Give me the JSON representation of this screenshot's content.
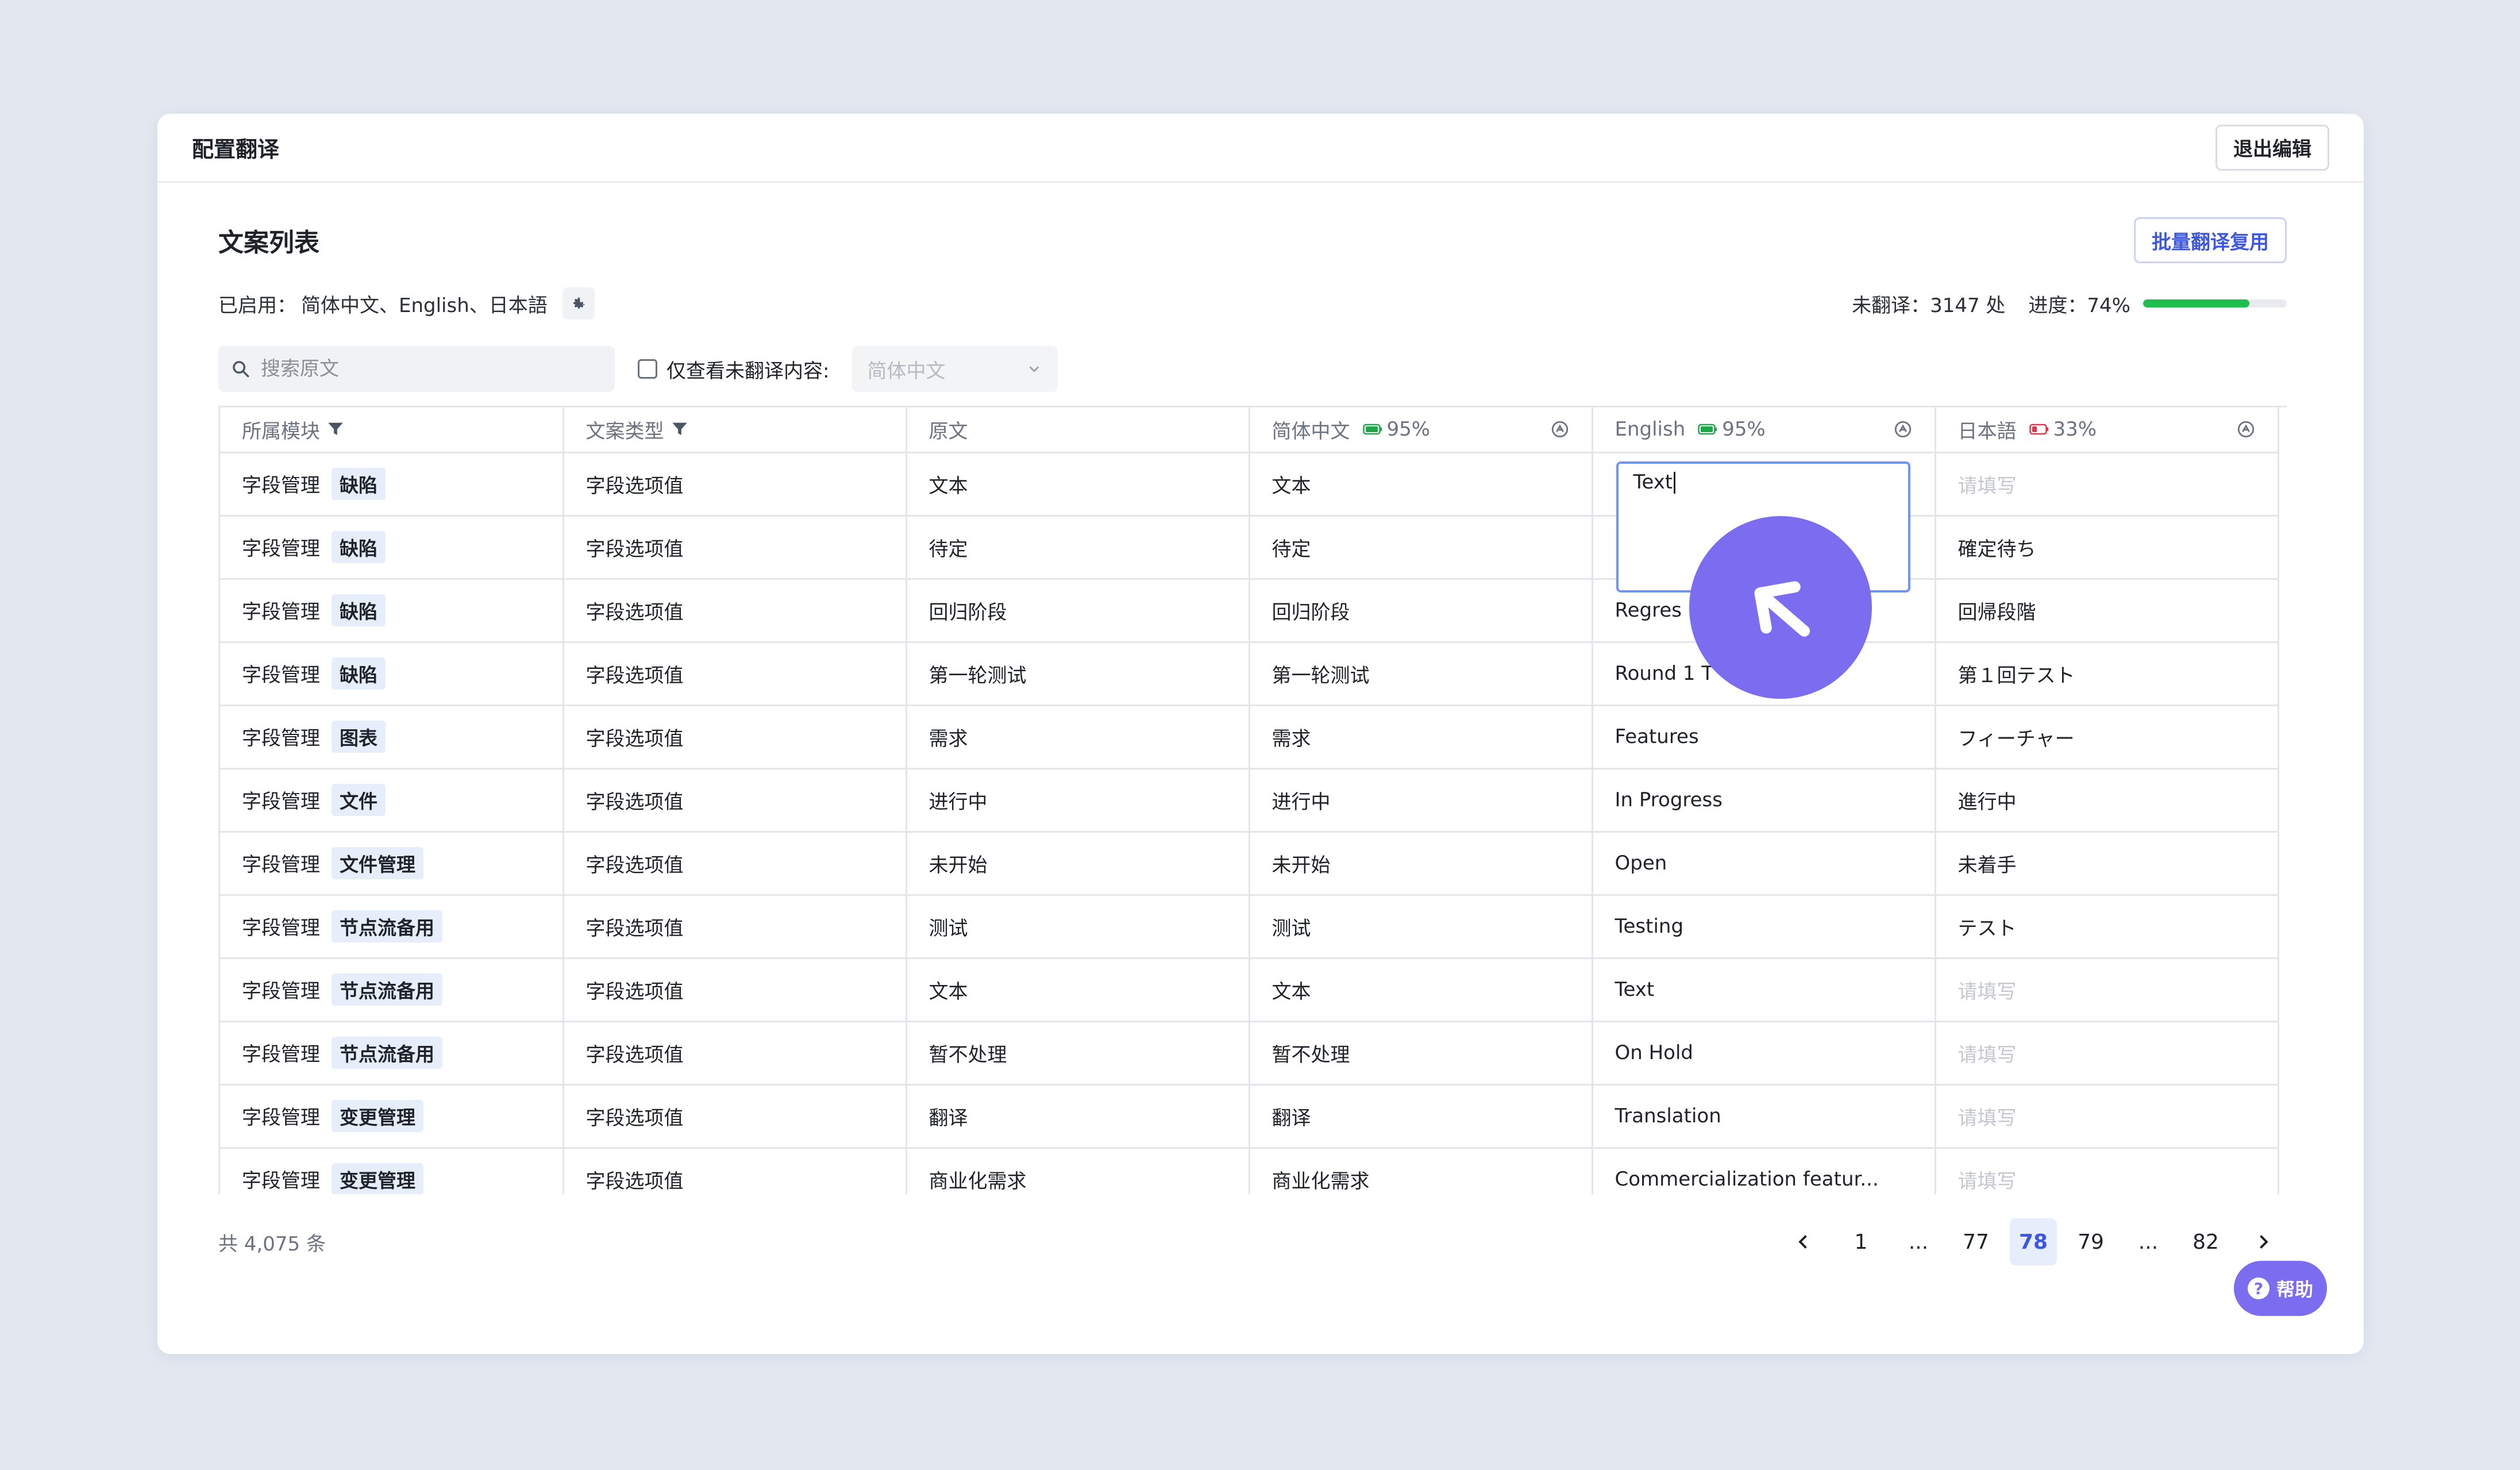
{
  "header": {
    "title": "配置翻译",
    "exit_label": "退出编辑"
  },
  "list": {
    "title": "文案列表",
    "batch_label": "批量翻译复用",
    "enabled_label": "已启用：",
    "enabled_langs": "简体中文、English、日本語",
    "untranslated_label": "未翻译：",
    "untranslated_value": "3147 处",
    "progress_label": "进度：",
    "progress_value": "74%",
    "progress_fraction": 0.74,
    "progress_color": "#1fbf4f"
  },
  "filters": {
    "search_placeholder": "搜索原文",
    "only_untranslated_label": "仅查看未翻译内容:",
    "language_select": "简体中文"
  },
  "columns": [
    {
      "label": "所属模块",
      "icon": "filter-icon"
    },
    {
      "label": "文案类型",
      "icon": "filter-icon"
    },
    {
      "label": "原文"
    },
    {
      "label": "简体中文",
      "pct": "95%",
      "battery": "battery-green-icon"
    },
    {
      "label": "English",
      "pct": "95%",
      "battery": "battery-green-icon"
    },
    {
      "label": "日本語",
      "pct": "33%",
      "battery": "battery-red-icon"
    }
  ],
  "rows": [
    {
      "module": "字段管理",
      "tag": "缺陷",
      "type": "字段选项值",
      "source": "文本",
      "zh": "文本",
      "en": "Text",
      "ja": "请填写",
      "ja_placeholder": true
    },
    {
      "module": "字段管理",
      "tag": "缺陷",
      "type": "字段选项值",
      "source": "待定",
      "zh": "待定",
      "en": "",
      "ja": "確定待ち"
    },
    {
      "module": "字段管理",
      "tag": "缺陷",
      "type": "字段选项值",
      "source": "回归阶段",
      "zh": "回归阶段",
      "en": "Regres",
      "ja": "回帰段階"
    },
    {
      "module": "字段管理",
      "tag": "缺陷",
      "type": "字段选项值",
      "source": "第一轮测试",
      "zh": "第一轮测试",
      "en": "Round 1 T",
      "ja": "第１回テスト"
    },
    {
      "module": "字段管理",
      "tag": "图表",
      "type": "字段选项值",
      "source": "需求",
      "zh": "需求",
      "en": "Features",
      "ja": "フィーチャー"
    },
    {
      "module": "字段管理",
      "tag": "文件",
      "type": "字段选项值",
      "source": "进行中",
      "zh": "进行中",
      "en": "In Progress",
      "ja": "進行中"
    },
    {
      "module": "字段管理",
      "tag": "文件管理",
      "type": "字段选项值",
      "source": "未开始",
      "zh": "未开始",
      "en": "Open",
      "ja": "未着手"
    },
    {
      "module": "字段管理",
      "tag": "节点流备用",
      "type": "字段选项值",
      "source": "测试",
      "zh": "测试",
      "en": "Testing",
      "ja": "テスト"
    },
    {
      "module": "字段管理",
      "tag": "节点流备用",
      "type": "字段选项值",
      "source": "文本",
      "zh": "文本",
      "en": "Text",
      "ja": "请填写",
      "ja_placeholder": true
    },
    {
      "module": "字段管理",
      "tag": "节点流备用",
      "type": "字段选项值",
      "source": "暂不处理",
      "zh": "暂不处理",
      "en": "On Hold",
      "ja": "请填写",
      "ja_placeholder": true
    },
    {
      "module": "字段管理",
      "tag": "变更管理",
      "type": "字段选项值",
      "source": "翻译",
      "zh": "翻译",
      "en": "Translation",
      "ja": "请填写",
      "ja_placeholder": true
    },
    {
      "module": "字段管理",
      "tag": "变更管理",
      "type": "字段选项值",
      "source": "商业化需求",
      "zh": "商业化需求",
      "en": "Commercialization featur...",
      "ja": "请填写",
      "ja_placeholder": true
    }
  ],
  "editor": {
    "value": "Text"
  },
  "footer": {
    "total": "共 4,075 条",
    "pages": [
      "1",
      "...",
      "77",
      "78",
      "79",
      "...",
      "82"
    ],
    "active_page": "78"
  },
  "help_label": "帮助"
}
